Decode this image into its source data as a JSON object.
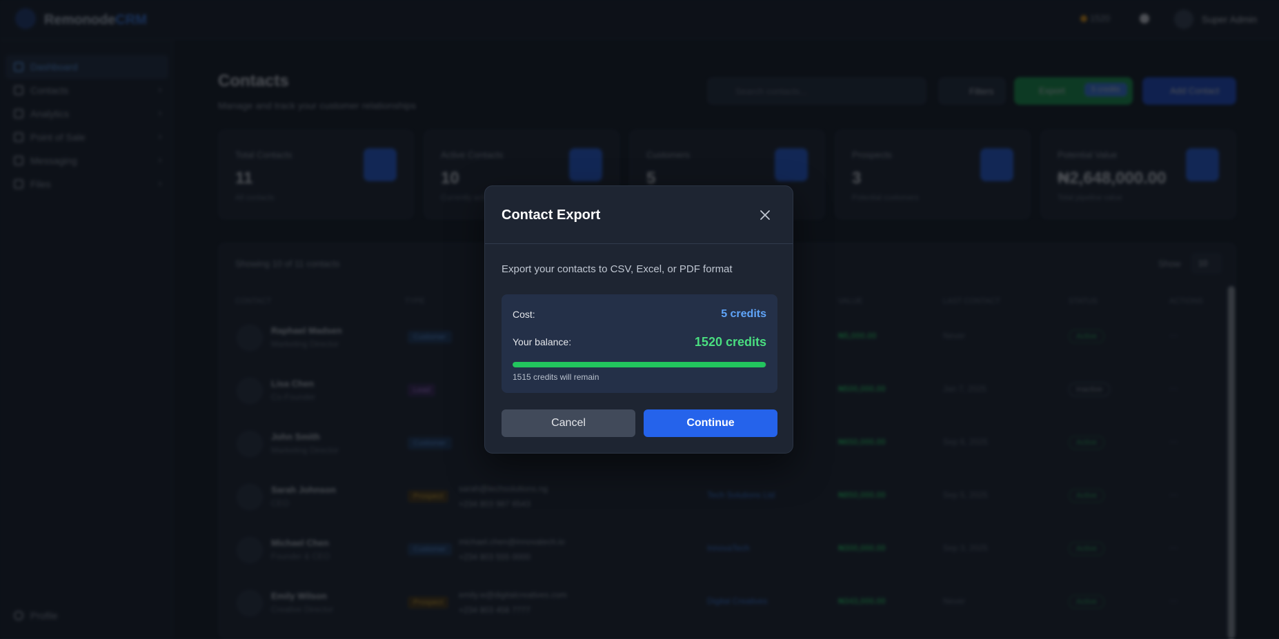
{
  "app": {
    "logo_main": "Remonode",
    "logo_accent": "CRM",
    "credits": "1520",
    "user_name": "Super Admin"
  },
  "sidebar": {
    "items": [
      {
        "label": "Dashboard"
      },
      {
        "label": "Contacts"
      },
      {
        "label": "Analytics"
      },
      {
        "label": "Point of Sale"
      },
      {
        "label": "Messaging"
      },
      {
        "label": "Files"
      }
    ],
    "profile_label": "Profile"
  },
  "page": {
    "title": "Contacts",
    "subtitle": "Manage and track your customer relationships",
    "search_placeholder": "Search contacts...",
    "filters_label": "Filters",
    "export_label": "Export",
    "export_badge": "5 credits",
    "add_label": "Add Contact"
  },
  "stats": [
    {
      "label": "Total Contacts",
      "value": "11",
      "note": "All contacts"
    },
    {
      "label": "Active Contacts",
      "value": "10",
      "note": "Currently active"
    },
    {
      "label": "Customers",
      "value": "5",
      "note": ""
    },
    {
      "label": "Prospects",
      "value": "3",
      "note": "Potential customers"
    },
    {
      "label": "Potential Value",
      "value": "₦2,648,000.00",
      "note": "Total pipeline value"
    }
  ],
  "table": {
    "showing": "Showing 10 of 11 contacts",
    "show_label": "Show",
    "show_value": "10",
    "headers": [
      "Contact",
      "Type",
      "Value",
      "Last Contact",
      "Status",
      "Actions"
    ],
    "rows": [
      {
        "name": "Raphael Madsen",
        "sub": "Marketing Director",
        "type": "Customer",
        "email": "",
        "phone": "",
        "company": "",
        "value": "₦5,000.00",
        "date": "Never",
        "status": "Active"
      },
      {
        "name": "Lisa Chen",
        "sub": "Co-Founder",
        "type": "Lead",
        "email": "",
        "phone": "",
        "company": "",
        "value": "₦500,000.00",
        "date": "Jan 7, 2025",
        "status": "Inactive"
      },
      {
        "name": "John Smith",
        "sub": "Marketing Director",
        "type": "Customer",
        "email": "",
        "phone": "",
        "company": "",
        "value": "₦650,000.00",
        "date": "Sep 6, 2025",
        "status": "Active"
      },
      {
        "name": "Sarah Johnson",
        "sub": "CEO",
        "type": "Prospect",
        "email": "sarah@techsolutions.ng",
        "phone": "+234 803 987 6543",
        "company": "Tech Solutions Ltd",
        "value": "₦850,000.00",
        "date": "Sep 5, 2025",
        "status": "Active"
      },
      {
        "name": "Michael Chen",
        "sub": "Founder & CEO",
        "type": "Customer",
        "email": "michael.chen@innovatech.io",
        "phone": "+234 803 555 0000",
        "company": "InnovaTech",
        "value": "₦300,000.00",
        "date": "Sep 3, 2025",
        "status": "Active"
      },
      {
        "name": "Emily Wilson",
        "sub": "Creative Director",
        "type": "Prospect",
        "email": "emily.w@digitalcreatives.com",
        "phone": "+234 803 456 7777",
        "company": "Digital Creatives",
        "value": "₦343,000.00",
        "date": "Never",
        "status": "Active"
      }
    ]
  },
  "modal": {
    "title": "Contact Export",
    "description": "Export your contacts to CSV, Excel, or PDF format",
    "cost_label": "Cost:",
    "cost_value": "5 credits",
    "balance_label": "Your balance:",
    "balance_value": "1520 credits",
    "remain_fraction": 0.9967,
    "remain_text": "1515 credits will remain",
    "cancel_label": "Cancel",
    "continue_label": "Continue",
    "colors": {
      "accent": "#2563eb",
      "cost": "#60a5fa",
      "balance": "#4ade80",
      "progress": "#22c55e"
    }
  }
}
